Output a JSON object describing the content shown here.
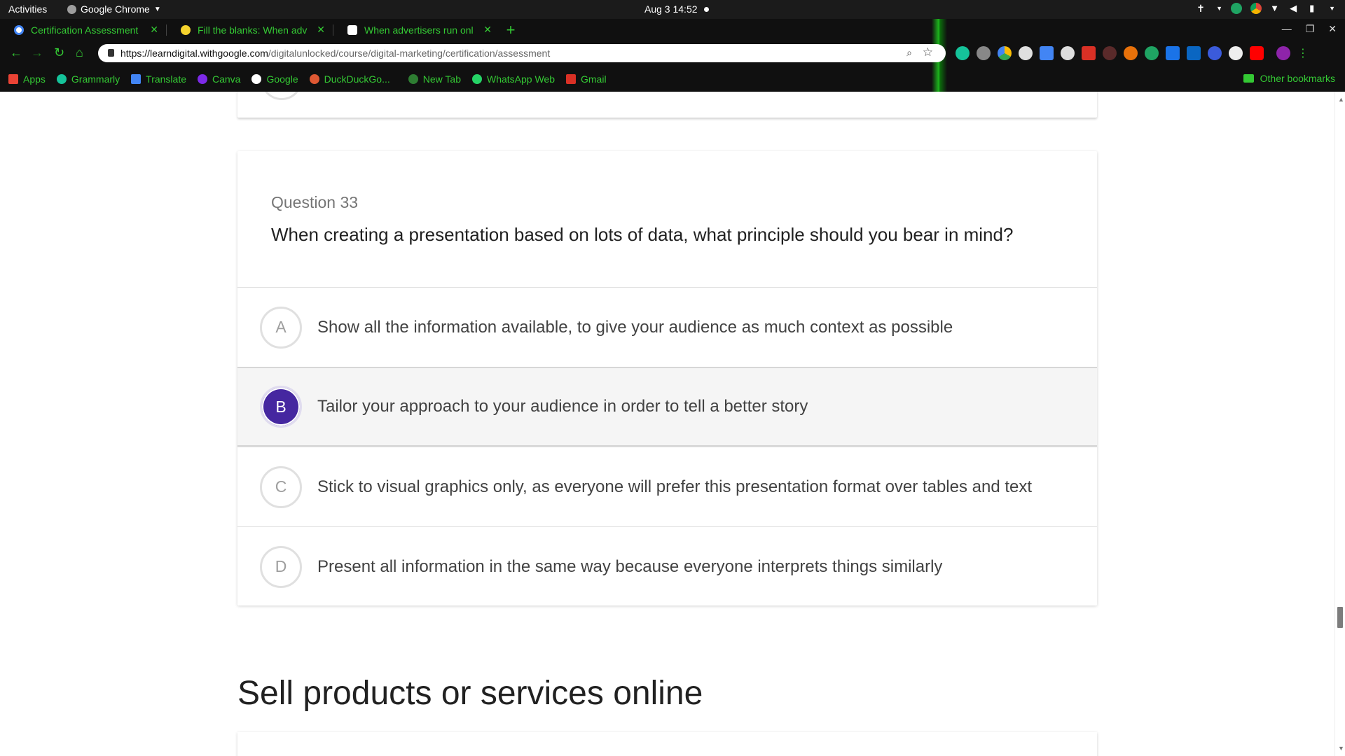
{
  "topbar": {
    "activities": "Activities",
    "app_name": "Google Chrome",
    "clock": "Aug 3  14:52"
  },
  "browser": {
    "tabs": [
      {
        "title": "Certification Assessment"
      },
      {
        "title": "Fill the blanks: When adv"
      },
      {
        "title": "When advertisers run onl"
      }
    ],
    "url_host": "https://learndigital.withgoogle.com",
    "url_path": "/digitalunlocked/course/digital-marketing/certification/assessment",
    "bookmarks": [
      {
        "label": "Apps"
      },
      {
        "label": "Grammarly"
      },
      {
        "label": "Translate"
      },
      {
        "label": "Canva"
      },
      {
        "label": "Google"
      },
      {
        "label": "DuckDuckGo..."
      },
      {
        "label": "New Tab"
      },
      {
        "label": "WhatsApp Web"
      },
      {
        "label": "Gmail"
      }
    ],
    "other_bookmarks": "Other bookmarks",
    "accent": "#34c934"
  },
  "question": {
    "number": "Question 33",
    "text": "When creating a presentation based on lots of data, what principle should you bear in mind?",
    "selected": "B",
    "options": [
      {
        "letter": "A",
        "text": "Show all the information available, to give your audience as much context as possible"
      },
      {
        "letter": "B",
        "text": "Tailor your approach to your audience in order to tell a better story"
      },
      {
        "letter": "C",
        "text": "Stick to visual graphics only, as everyone will prefer this presentation format over tables and text"
      },
      {
        "letter": "D",
        "text": "Present all information in the same way because everyone interprets things similarly"
      }
    ]
  },
  "next_section": {
    "title": "Sell products or services online"
  },
  "colors": {
    "selected_accent": "#4527a0"
  }
}
